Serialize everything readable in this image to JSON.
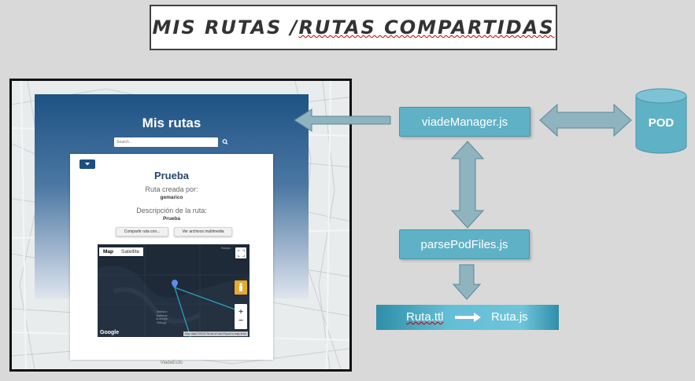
{
  "title": "MIS RUTAS / RUTAS COMPARTIDAS",
  "title_underlined_part": "RUTAS COMPARTIDAS",
  "title_plain_part": "MIS RUTAS / ",
  "screenshot": {
    "app_title": "Mis rutas",
    "search_placeholder": "Search...",
    "route_name": "Prueba",
    "created_by_label": "Ruta creada por:",
    "created_by_value": "gemarico",
    "description_label": "Descripción de la ruta:",
    "description_value": "Prueba",
    "share_button": "Compartir ruta con...",
    "media_button": "Ver archivos multimedia",
    "map_tab_map": "Map",
    "map_tab_satellite": "Satellite",
    "map_place": "Sheldon\nNational\nAntelope\nRefuge",
    "map_place_2": "Ramps",
    "google_logo": "Google",
    "map_attribution": "Map data ©2019   Terms of Use   Report a map error",
    "footer": "ViadeEs3c"
  },
  "nodes": {
    "viade_manager": "viadeManager.js",
    "parse_pod_files": "parsePodFiles.js",
    "pod": "POD",
    "ruta_ttl": "Ruta.ttl",
    "ruta_js": "Ruta.js"
  },
  "colors": {
    "node_fill": "#5fb1c6",
    "arrow_fill": "#8fb3bf",
    "header_top": "#1d5284",
    "title_underline": "#c00000"
  }
}
